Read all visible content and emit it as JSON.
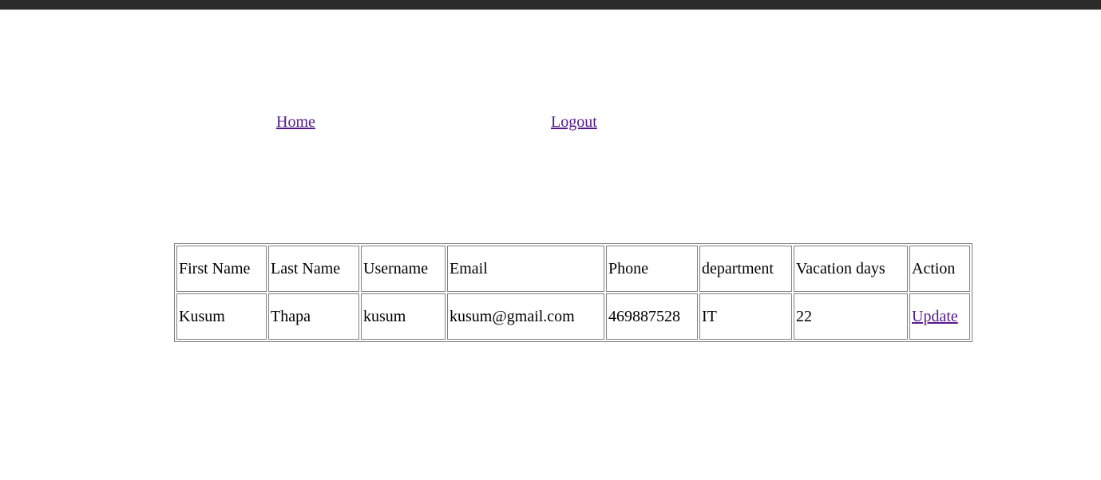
{
  "nav": {
    "home_label": "Home",
    "logout_label": "Logout",
    "link_color": "#551a8b"
  },
  "table": {
    "headers": [
      "First Name",
      "Last Name",
      "Username",
      "Email",
      "Phone",
      "department",
      "Vacation days",
      "Action"
    ],
    "rows": [
      {
        "first_name": "Kusum",
        "last_name": "Thapa",
        "username": "kusum",
        "email": "kusum@gmail.com",
        "phone": "469887528",
        "department": "IT",
        "vacation_days": "22",
        "action_label": "Update"
      }
    ]
  }
}
